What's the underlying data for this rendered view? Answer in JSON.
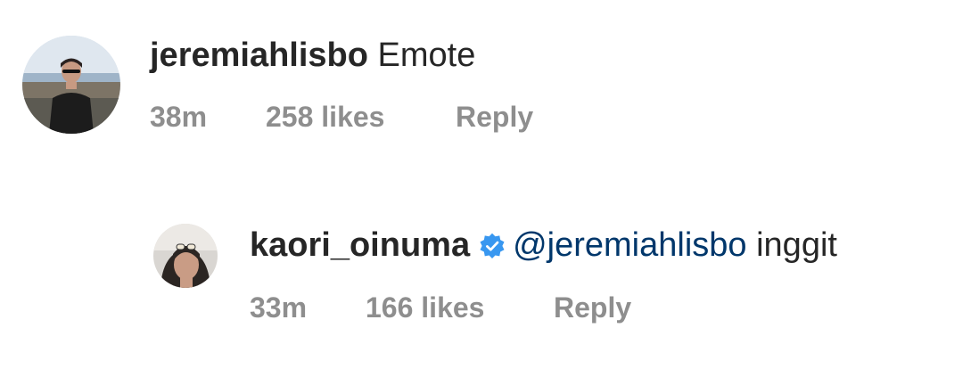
{
  "comments": [
    {
      "username": "jeremiahlisbo",
      "text": "Emote",
      "time": "38m",
      "likes": "258 likes",
      "reply_label": "Reply"
    },
    {
      "username": "kaori_oinuma",
      "verified": true,
      "mention": "@jeremiahlisbo",
      "text": "inggit",
      "time": "33m",
      "likes": "166 likes",
      "reply_label": "Reply"
    }
  ],
  "colors": {
    "text": "#262626",
    "secondary": "#8e8e8e",
    "mention": "#00376b",
    "verified_badge": "#3897f0"
  }
}
